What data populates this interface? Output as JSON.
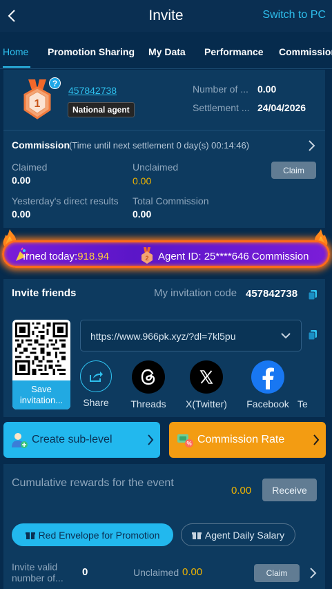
{
  "header": {
    "title": "Invite",
    "switch_label": "Switch to PC"
  },
  "tabs": [
    {
      "label": "Home"
    },
    {
      "label": "Promotion Sharing"
    },
    {
      "label": "My Data"
    },
    {
      "label": "Performance"
    },
    {
      "label": "Commission"
    }
  ],
  "agent": {
    "level_number": "1",
    "user_id": "457842738",
    "level_name": "National agent",
    "stats": [
      {
        "label": "Number of ...",
        "value": "0.00"
      },
      {
        "label": "Settlement ...",
        "value": "24/04/2026"
      }
    ]
  },
  "commission": {
    "title": "Commission",
    "timer": "(Time until next settlement 0 day(s) 00:14:46)",
    "claimed_label": "Claimed",
    "claimed_value": "0.00",
    "unclaimed_label": "Unclaimed",
    "unclaimed_value": "0.00",
    "claim_button": "Claim",
    "yesterday_label": "Yesterday's direct results",
    "yesterday_value": "0.00",
    "total_label": "Total Commission",
    "total_value": "0.00"
  },
  "marquee": {
    "earned_prefix": "ırned today:",
    "earned_amount": "918.94",
    "agent_text": "Agent ID: 25****646 Commission"
  },
  "invite": {
    "title": "Invite friends",
    "code_label": "My invitation code",
    "code": "457842738",
    "qr_save_label_1": "Save",
    "qr_save_label_2": "invitation...",
    "url": "https://www.966pk.xyz/?dl=7kl5pu",
    "share": [
      {
        "label": "Share",
        "icon": "share-icon"
      },
      {
        "label": "Threads",
        "icon": "threads-icon"
      },
      {
        "label": "X(Twitter)",
        "icon": "x-twitter-icon"
      },
      {
        "label": "Facebook",
        "icon": "facebook-icon"
      },
      {
        "label": "Te",
        "icon": "telegram-icon"
      }
    ]
  },
  "actions": {
    "create_sub_level": "Create sub-level",
    "commission_rate": "Commission Rate"
  },
  "event": {
    "title": "Cumulative rewards for the event",
    "amount": "0.00",
    "receive_button": "Receive",
    "pill_red_envelope": "Red Envelope for Promotion",
    "pill_agent_salary": "Agent Daily Salary",
    "invite_valid_label_1": "Invite valid",
    "invite_valid_label_2": "number of...",
    "invite_valid_value": "0",
    "unclaimed_label": "Unclaimed",
    "unclaimed_value": "0.00",
    "claim_button": "Claim"
  },
  "colors": {
    "background": "#062b4d",
    "panel": "#0d3a5f",
    "accent": "#2ec0ee",
    "gold": "#f0b400",
    "commission_rate_bg": "#f39c12",
    "create_sub_level_bg": "#22b8ee"
  }
}
